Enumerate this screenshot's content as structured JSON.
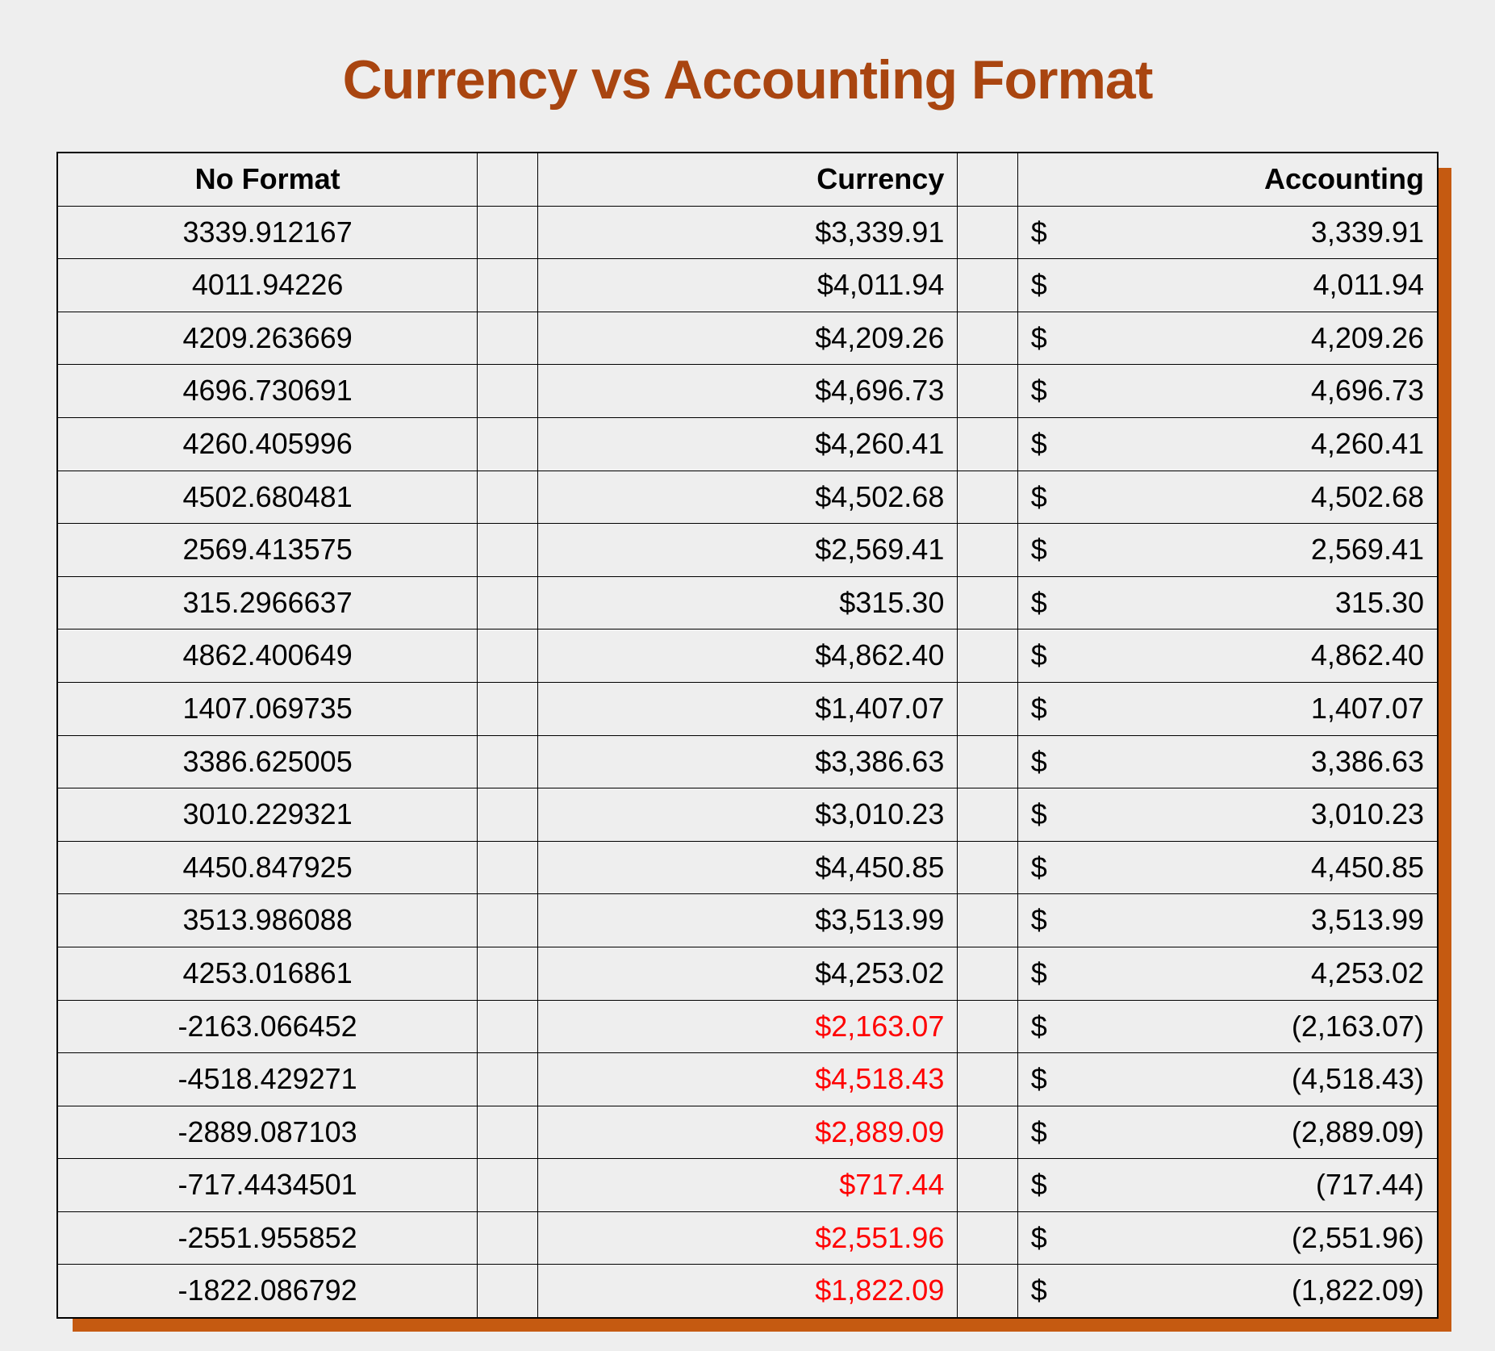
{
  "title": "Currency vs Accounting Format",
  "headers": {
    "noformat": "No Format",
    "currency": "Currency",
    "accounting": "Accounting"
  },
  "rows": [
    {
      "noformat": "3339.912167",
      "currency": "$3,339.91",
      "currency_negative": false,
      "acc_sign": "$",
      "acc_value": "3,339.91"
    },
    {
      "noformat": "4011.94226",
      "currency": "$4,011.94",
      "currency_negative": false,
      "acc_sign": "$",
      "acc_value": "4,011.94"
    },
    {
      "noformat": "4209.263669",
      "currency": "$4,209.26",
      "currency_negative": false,
      "acc_sign": "$",
      "acc_value": "4,209.26"
    },
    {
      "noformat": "4696.730691",
      "currency": "$4,696.73",
      "currency_negative": false,
      "acc_sign": "$",
      "acc_value": "4,696.73"
    },
    {
      "noformat": "4260.405996",
      "currency": "$4,260.41",
      "currency_negative": false,
      "acc_sign": "$",
      "acc_value": "4,260.41"
    },
    {
      "noformat": "4502.680481",
      "currency": "$4,502.68",
      "currency_negative": false,
      "acc_sign": "$",
      "acc_value": "4,502.68"
    },
    {
      "noformat": "2569.413575",
      "currency": "$2,569.41",
      "currency_negative": false,
      "acc_sign": "$",
      "acc_value": "2,569.41"
    },
    {
      "noformat": "315.2966637",
      "currency": "$315.30",
      "currency_negative": false,
      "acc_sign": "$",
      "acc_value": "315.30"
    },
    {
      "noformat": "4862.400649",
      "currency": "$4,862.40",
      "currency_negative": false,
      "acc_sign": "$",
      "acc_value": "4,862.40"
    },
    {
      "noformat": "1407.069735",
      "currency": "$1,407.07",
      "currency_negative": false,
      "acc_sign": "$",
      "acc_value": "1,407.07"
    },
    {
      "noformat": "3386.625005",
      "currency": "$3,386.63",
      "currency_negative": false,
      "acc_sign": "$",
      "acc_value": "3,386.63"
    },
    {
      "noformat": "3010.229321",
      "currency": "$3,010.23",
      "currency_negative": false,
      "acc_sign": "$",
      "acc_value": "3,010.23"
    },
    {
      "noformat": "4450.847925",
      "currency": "$4,450.85",
      "currency_negative": false,
      "acc_sign": "$",
      "acc_value": "4,450.85"
    },
    {
      "noformat": "3513.986088",
      "currency": "$3,513.99",
      "currency_negative": false,
      "acc_sign": "$",
      "acc_value": "3,513.99"
    },
    {
      "noformat": "4253.016861",
      "currency": "$4,253.02",
      "currency_negative": false,
      "acc_sign": "$",
      "acc_value": "4,253.02"
    },
    {
      "noformat": "-2163.066452",
      "currency": "$2,163.07",
      "currency_negative": true,
      "acc_sign": "$",
      "acc_value": "(2,163.07)"
    },
    {
      "noformat": "-4518.429271",
      "currency": "$4,518.43",
      "currency_negative": true,
      "acc_sign": "$",
      "acc_value": "(4,518.43)"
    },
    {
      "noformat": "-2889.087103",
      "currency": "$2,889.09",
      "currency_negative": true,
      "acc_sign": "$",
      "acc_value": "(2,889.09)"
    },
    {
      "noformat": "-717.4434501",
      "currency": "$717.44",
      "currency_negative": true,
      "acc_sign": "$",
      "acc_value": "(717.44)"
    },
    {
      "noformat": "-2551.955852",
      "currency": "$2,551.96",
      "currency_negative": true,
      "acc_sign": "$",
      "acc_value": "(2,551.96)"
    },
    {
      "noformat": "-1822.086792",
      "currency": "$1,822.09",
      "currency_negative": true,
      "acc_sign": "$",
      "acc_value": "(1,822.09)"
    }
  ]
}
